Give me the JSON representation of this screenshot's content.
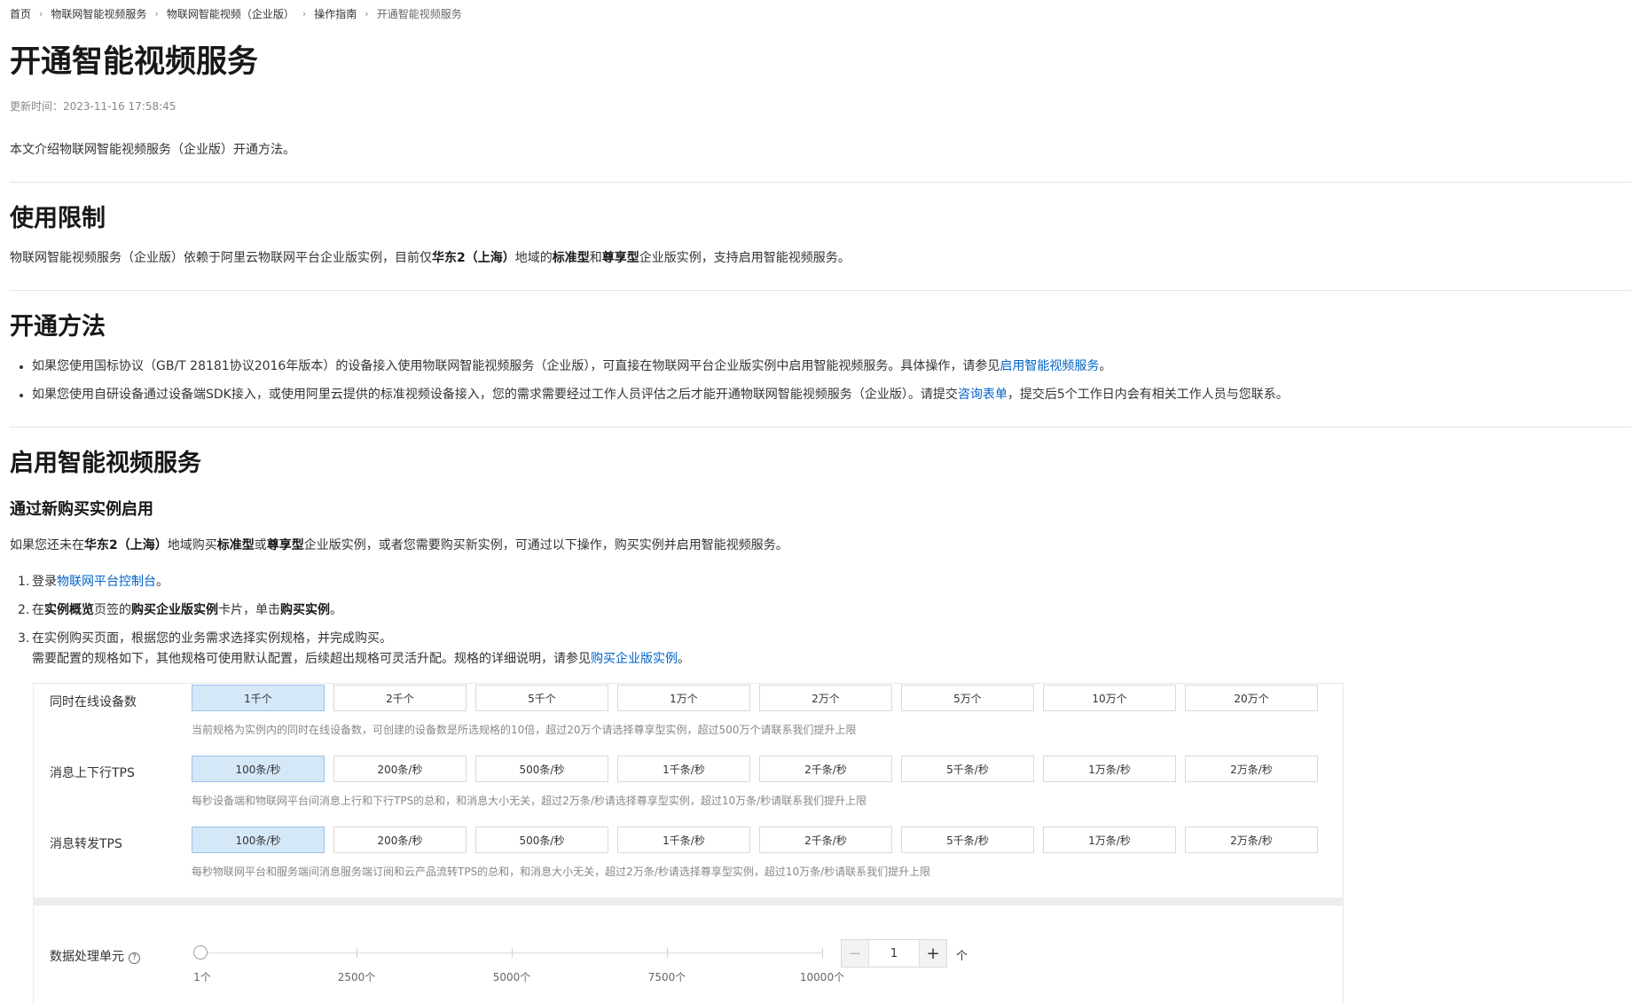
{
  "breadcrumb": [
    "首页",
    "物联网智能视频服务",
    "物联网智能视频（企业版）",
    "操作指南",
    "开通智能视频服务"
  ],
  "page_title": "开通智能视频服务",
  "update_time": "更新时间：2023-11-16 17:58:45",
  "intro": "本文介绍物联网智能视频服务（企业版）开通方法。",
  "limits": {
    "heading": "使用限制",
    "p1": "物联网智能视频服务（企业版）依赖于阿里云物联网平台企业版实例，目前仅",
    "b1": "华东2（上海）",
    "p2": "地域的",
    "b2": "标准型",
    "p3": "和",
    "b3": "尊享型",
    "p4": "企业版实例，支持启用智能视频服务。"
  },
  "methods": {
    "heading": "开通方法",
    "bullet1_text": "如果您使用国标协议（GB/T 28181协议2016年版本）的设备接入使用物联网智能视频服务（企业版），可直接在物联网平台企业版实例中启用智能视频服务。具体操作，请参见",
    "bullet1_link": "启用智能视频服务",
    "bullet1_end": "。",
    "bullet2_text": "如果您使用自研设备通过设备端SDK接入，或使用阿里云提供的标准视频设备接入，您的需求需要经过工作人员评估之后才能开通物联网智能视频服务（企业版）。请提交",
    "bullet2_link": "咨询表单",
    "bullet2_end": "，提交后5个工作日内会有相关工作人员与您联系。"
  },
  "enable": {
    "heading": "启用智能视频服务",
    "sub_heading": "通过新购买实例启用",
    "p1": "如果您还未在",
    "b1": "华东2（上海）",
    "p2": "地域购买",
    "b2": "标准型",
    "p3": "或",
    "b3": "尊享型",
    "p4": "企业版实例，或者您需要购买新实例，可通过以下操作，购买实例并启用智能视频服务。",
    "step1_num": "1.",
    "step1_text": "登录",
    "step1_link": "物联网平台控制台",
    "step1_end": "。",
    "step2_num": "2.",
    "step2_a": "在",
    "step2_b1": "实例概览",
    "step2_c": "页签的",
    "step2_b2": "购买企业版实例",
    "step2_d": "卡片，单击",
    "step2_b3": "购买实例",
    "step2_e": "。",
    "step3_num": "3.",
    "step3_text": "在实例购买页面，根据您的业务需求选择实例规格，并完成购买。",
    "step3_sub": "需要配置的规格如下，其他规格可使用默认配置，后续超出规格可灵活升配。规格的详细说明，请参见",
    "step3_link": "购买企业版实例",
    "step3_end": "。"
  },
  "spec_panel": {
    "rows": [
      {
        "label": "同时在线设备数",
        "selected": 0,
        "options": [
          "1千个",
          "2千个",
          "5千个",
          "1万个",
          "2万个",
          "5万个",
          "10万个",
          "20万个"
        ],
        "hint": "当前规格为实例内的同时在线设备数，可创建的设备数是所选规格的10倍，超过20万个请选择尊享型实例，超过500万个请联系我们提升上限"
      },
      {
        "label": "消息上下行TPS",
        "selected": 0,
        "options": [
          "100条/秒",
          "200条/秒",
          "500条/秒",
          "1千条/秒",
          "2千条/秒",
          "5千条/秒",
          "1万条/秒",
          "2万条/秒"
        ],
        "hint": "每秒设备端和物联网平台间消息上行和下行TPS的总和，和消息大小无关，超过2万条/秒请选择尊享型实例，超过10万条/秒请联系我们提升上限"
      },
      {
        "label": "消息转发TPS",
        "selected": 0,
        "options": [
          "100条/秒",
          "200条/秒",
          "500条/秒",
          "1千条/秒",
          "2千条/秒",
          "5千条/秒",
          "1万条/秒",
          "2万条/秒"
        ],
        "hint": "每秒物联网平台和服务端间消息服务端订阅和云产品流转TPS的总和，和消息大小无关，超过2万条/秒请选择尊享型实例，超过10万条/秒请联系我们提升上限"
      }
    ],
    "data_unit": {
      "label": "数据处理单元",
      "help_icon": "question-circle-icon",
      "slider_marks": [
        "1个",
        "2500个",
        "5000个",
        "7500个",
        "10000个"
      ],
      "slider_value": 1,
      "stepper_value": "1",
      "minus": "−",
      "plus": "+",
      "unit": "个"
    }
  },
  "colors": {
    "link": "#0064c8",
    "selected_bg": "#d5e8f8",
    "text": "#333333"
  }
}
